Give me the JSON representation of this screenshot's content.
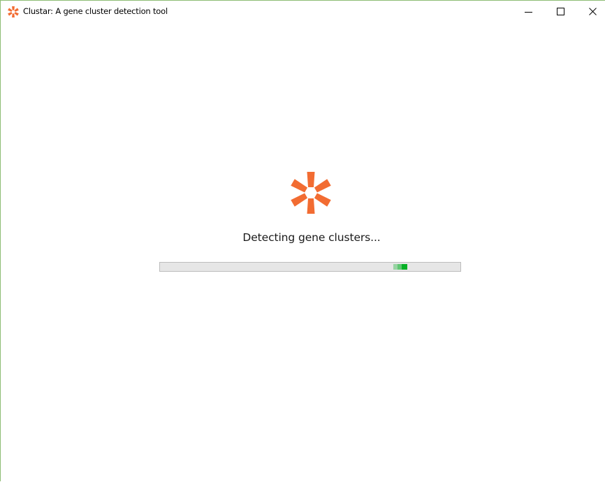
{
  "window": {
    "title": "Clustar: A gene cluster detection tool",
    "app_icon": "clustar-logo-icon",
    "controls": {
      "minimize_icon": "minimize-icon",
      "maximize_icon": "maximize-icon",
      "close_icon": "close-icon"
    }
  },
  "loading": {
    "logo_icon": "clustar-logo-icon",
    "status_text": "Detecting gene clusters...",
    "progress": {
      "mode": "indeterminate",
      "marquee_position_fraction": 0.8
    }
  },
  "colors": {
    "brand_orange": "#f26c32",
    "progress_track": "#e6e6e6",
    "progress_border": "#bcbcbc",
    "progress_fill": "#06b025",
    "window_border": "#8dbc74"
  }
}
